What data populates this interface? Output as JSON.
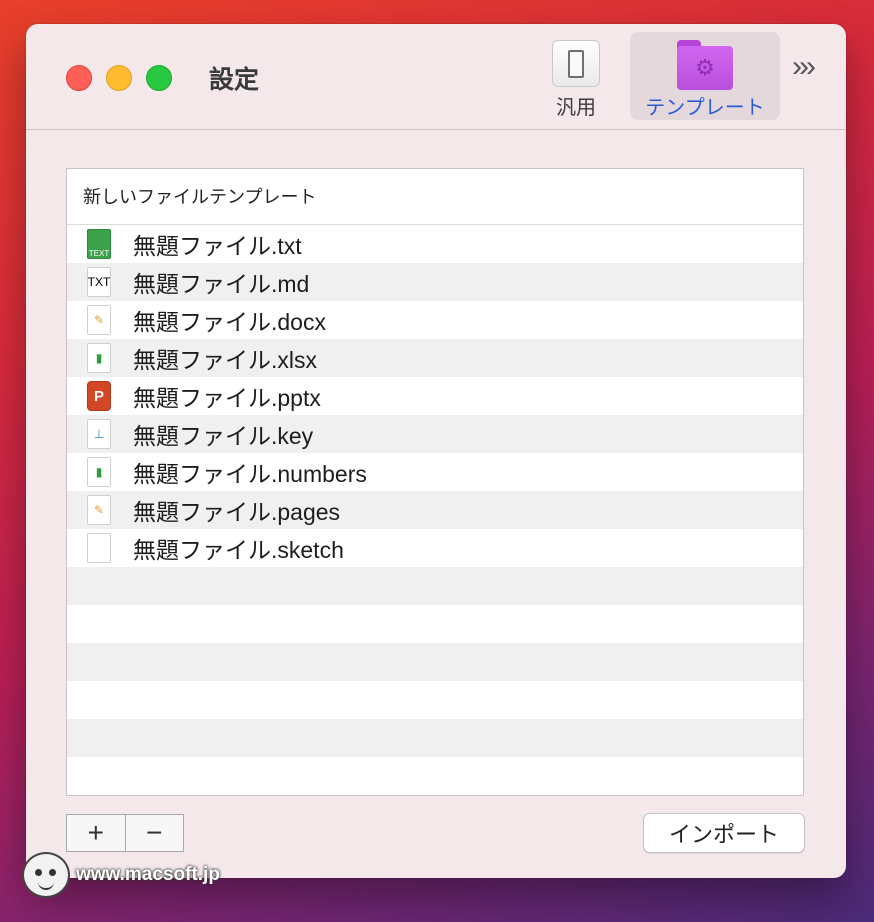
{
  "window": {
    "title": "設定"
  },
  "toolbar": {
    "general_label": "汎用",
    "template_label": "テンプレート",
    "overflow_icon": "chevron-double-right-icon"
  },
  "list": {
    "header": "新しいファイルテンプレート",
    "items": [
      {
        "label": "無題ファイル.txt",
        "icon": "text-file-icon",
        "icon_text": "TEXT"
      },
      {
        "label": "無題ファイル.md",
        "icon": "markdown-file-icon",
        "icon_text": "TXT"
      },
      {
        "label": "無題ファイル.docx",
        "icon": "document-file-icon"
      },
      {
        "label": "無題ファイル.xlsx",
        "icon": "spreadsheet-file-icon"
      },
      {
        "label": "無題ファイル.pptx",
        "icon": "powerpoint-file-icon",
        "icon_text": "P"
      },
      {
        "label": "無題ファイル.key",
        "icon": "keynote-file-icon"
      },
      {
        "label": "無題ファイル.numbers",
        "icon": "numbers-file-icon"
      },
      {
        "label": "無題ファイル.pages",
        "icon": "pages-file-icon"
      },
      {
        "label": "無題ファイル.sketch",
        "icon": "blank-file-icon"
      }
    ]
  },
  "footer": {
    "add_label": "+",
    "remove_label": "−",
    "import_label": "インポート"
  },
  "watermark": {
    "text": "www.macsoft.jp"
  },
  "colors": {
    "accent": "#2a5bd7",
    "folder": "#c05ae6",
    "close": "#fe5f57",
    "minimize": "#febc2e",
    "zoom": "#28c840"
  }
}
